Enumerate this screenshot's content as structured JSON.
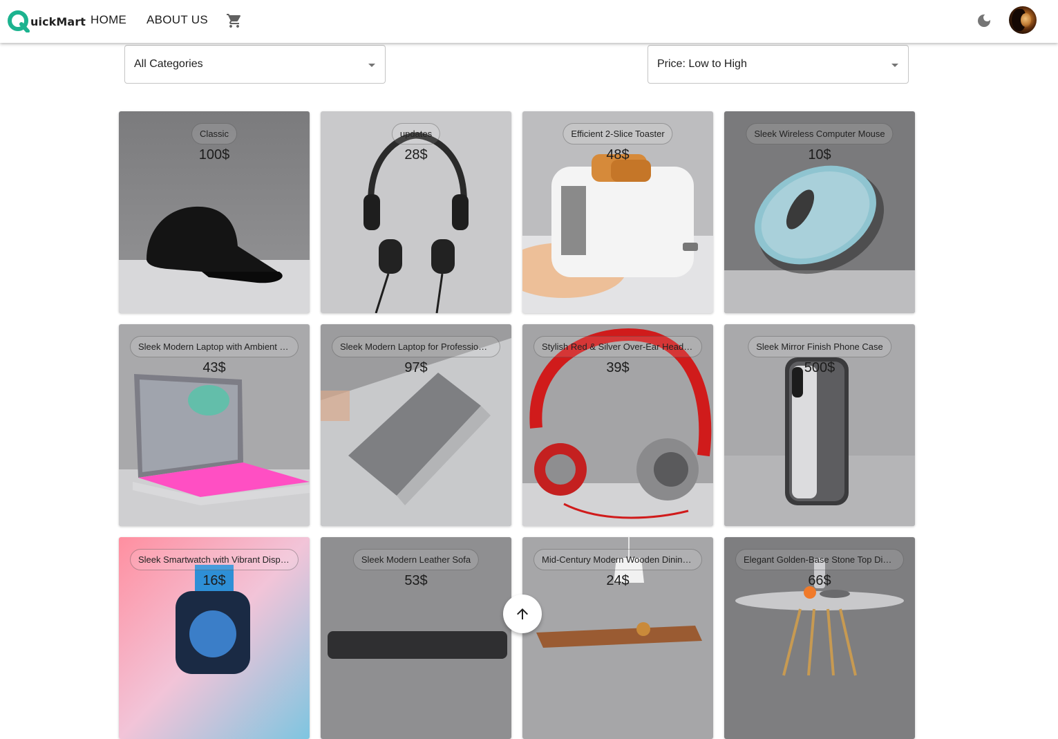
{
  "app": {
    "name": "QuickMart",
    "logo_letter": "Q",
    "logo_rest": "uickMart",
    "brand_color": "#1cb38f"
  },
  "nav": {
    "home": "HOME",
    "about": "ABOUT US",
    "cart_icon": "shopping-cart-icon",
    "theme_icon": "dark-mode-moon-icon"
  },
  "filters": {
    "category": "All Categories",
    "sort": "Price: Low to High"
  },
  "products": [
    {
      "name": "Classic",
      "price": "100$",
      "image": "black baseball cap"
    },
    {
      "name": "updates",
      "price": "28$",
      "image": "black headphones"
    },
    {
      "name": "Efficient 2-Slice Toaster",
      "price": "48$",
      "image": "white toaster"
    },
    {
      "name": "Sleek Wireless Computer Mouse",
      "price": "10$",
      "image": "translucent blue mouse"
    },
    {
      "name": "Sleek Modern Laptop with Ambient Lighting",
      "price": "43$",
      "image": "laptop with pink light"
    },
    {
      "name": "Sleek Modern Laptop for Professionals",
      "price": "97$",
      "image": "silver laptop"
    },
    {
      "name": "Stylish Red & Silver Over-Ear Headphones",
      "price": "39$",
      "image": "red headphones"
    },
    {
      "name": "Sleek Mirror Finish Phone Case",
      "price": "500$",
      "image": "mirror phone case"
    },
    {
      "name": "Sleek Smartwatch with Vibrant Display",
      "price": "16$",
      "image": "smartwatch"
    },
    {
      "name": "Sleek Modern Leather Sofa",
      "price": "53$",
      "image": "leather sofa"
    },
    {
      "name": "Mid-Century Modern Wooden Dining Table",
      "price": "24$",
      "image": "wooden table with lamp"
    },
    {
      "name": "Elegant Golden-Base Stone Top Dining Table",
      "price": "66$",
      "image": "round stone table"
    }
  ],
  "scroll_top_icon": "arrow-up-icon"
}
